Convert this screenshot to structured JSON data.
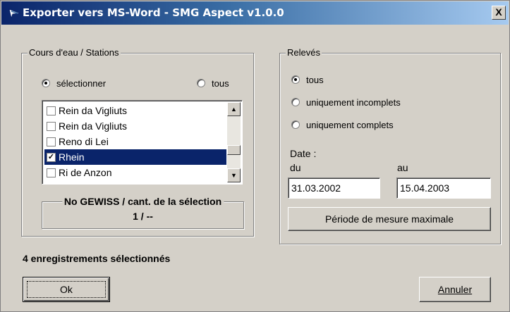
{
  "window": {
    "title": "Exporter vers MS-Word - SMG Aspect v1.0.0",
    "close_label": "X"
  },
  "stations": {
    "group_label": "Cours d'eau / Stations",
    "radio_select_label": "sélectionner",
    "radio_all_label": "tous",
    "selected_radio": "sélectionner",
    "items": [
      {
        "label": "Rein da Vigliuts",
        "checked": false,
        "selected": false
      },
      {
        "label": "Rein da Vigliuts",
        "checked": false,
        "selected": false
      },
      {
        "label": "Reno di Lei",
        "checked": false,
        "selected": false
      },
      {
        "label": "Rhein",
        "checked": true,
        "selected": true
      },
      {
        "label": "Ri de Anzon",
        "checked": false,
        "selected": false
      }
    ],
    "gewiss_label": "No GEWISS / cant. de la sélection",
    "gewiss_value": "1 / --"
  },
  "releves": {
    "group_label": "Relevés",
    "radio_all_label": "tous",
    "radio_incomplete_label": "uniquement incomplets",
    "radio_complete_label": "uniquement complets",
    "selected_radio": "tous",
    "date_label": "Date :",
    "from_label": "du",
    "to_label": "au",
    "from_value": "31.03.2002",
    "to_value": "15.04.2003",
    "max_period_button": "Période de mesure maximale"
  },
  "status": "4 enregistrements sélectionnés",
  "buttons": {
    "ok_label": "Ok",
    "cancel_label": "Annuler"
  },
  "colors": {
    "title_bar": "#0a246a",
    "selection": "#0a246a",
    "face": "#d4d0c8"
  }
}
